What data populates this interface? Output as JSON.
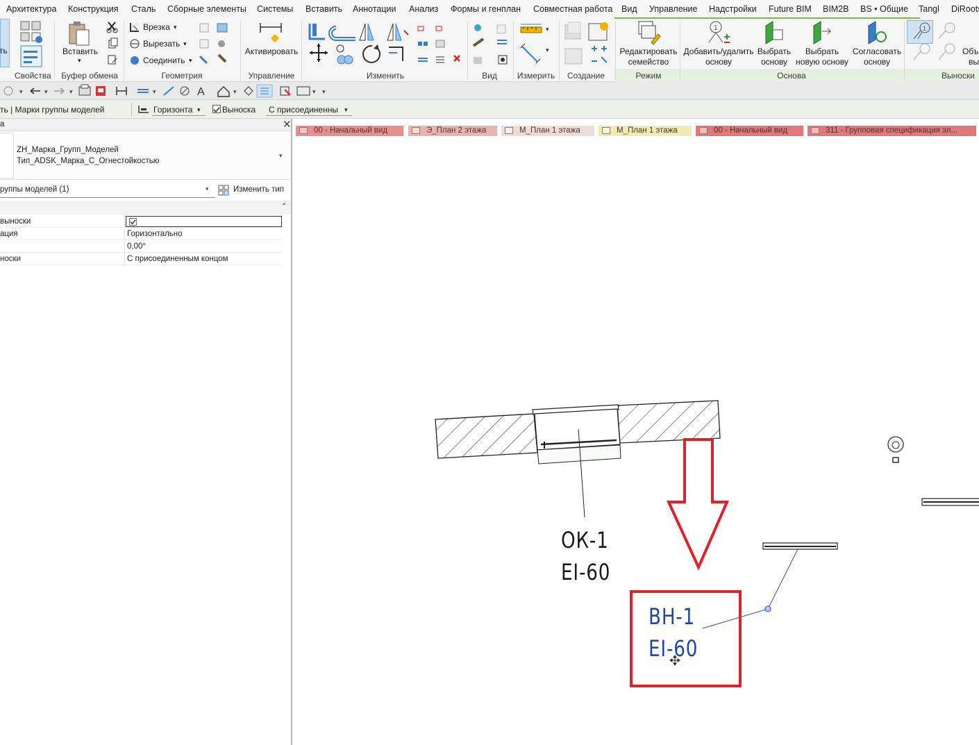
{
  "menu": {
    "tabs": [
      "Архитектура",
      "Конструкция",
      "Сталь",
      "Сборные элементы",
      "Системы",
      "Вставить",
      "Аннотации",
      "Анализ",
      "Формы и генплан",
      "Совместная работа",
      "Вид",
      "Управление",
      "Надстройки",
      "Future BIM",
      "BIM2B",
      "BS • Общие",
      "Tangl",
      "DiRoots"
    ]
  },
  "ribbon": {
    "properties_tab_label": "ть",
    "properties_label": "Свойства",
    "paste_label": "Вставить",
    "clipboard_label": "Буфер обмена",
    "cut_label": "Врезка",
    "cutout_label": "Вырезать",
    "join_label": "Соединить",
    "geometry_label": "Геометрия",
    "activate_label": "Активировать",
    "control_label": "Управление",
    "modify_label": "Изменить",
    "view_label": "Вид",
    "measure_label": "Измерить",
    "create_label": "Создание",
    "edit_family_label_1": "Редактировать",
    "edit_family_label_2": "семейство",
    "mode_label": "Режим",
    "add_remove_host_1": "Добавить/удалить",
    "add_remove_host_2": "основу",
    "pick_host_1": "Выбрать",
    "pick_host_2": "основу",
    "pick_new_host_1": "Выбрать",
    "pick_new_host_2": "новую основу",
    "reconcile_host_1": "Согласовать",
    "reconcile_host_2": "основу",
    "host_label": "Основа",
    "leaders_label": "Выноски",
    "obj_label_1": "Объ",
    "obj_label_2": "вы"
  },
  "optbar": {
    "context_label": "ть | Марки группы моделей",
    "orientation_value": "Горизонта",
    "leader_label": "Выноска",
    "leader_checked": true,
    "attach_value": "С присоединенны"
  },
  "properties": {
    "header": "а",
    "family_name": "ZH_Марка_Групп_Моделей",
    "type_name": "Тип_ADSK_Марка_С_Огнестойкостью",
    "filter_value": "руппы моделей (1)",
    "edit_type_label": "Изменить тип",
    "rows": [
      {
        "key": "выноски",
        "value": "",
        "checkbox": true
      },
      {
        "key": "ация",
        "value": "Горизонтально"
      },
      {
        "key": "",
        "value": "0,00°"
      },
      {
        "key": "носки",
        "value": "С присоединенным концом"
      }
    ]
  },
  "view_tabs": [
    {
      "label": "00 - Начальный вид",
      "color": "#e58f8f"
    },
    {
      "label": "Э_План 2 этажа",
      "color": "#e8b3b3"
    },
    {
      "label": "М_План 1 этажа",
      "color": "#eddcdc"
    },
    {
      "label": "М_План 1 этажа",
      "color": "#ecebb0"
    },
    {
      "label": "00 - Начальный вид",
      "color": "#e07a7a"
    },
    {
      "label": "311 - Групповая спецификация эл...",
      "color": "#e07a7a"
    }
  ],
  "drawing": {
    "tag1_line1": "ОК-1",
    "tag1_line2": "EI-60",
    "tag2_line1": "ВН-1",
    "tag2_line2": "EI-60",
    "tag2_color": "#1f45b5",
    "highlight_color": "#e0202a"
  }
}
